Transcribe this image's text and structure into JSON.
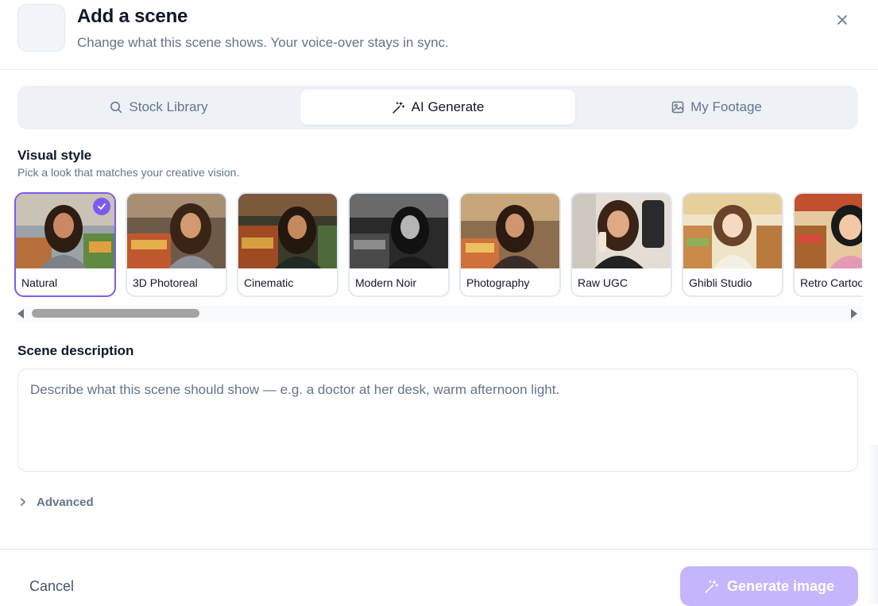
{
  "header": {
    "title": "Add a scene",
    "subtitle": "Change what this scene shows. Your voice-over stays in sync.",
    "close_icon": "close-icon"
  },
  "tabs": [
    {
      "label": "Stock Library",
      "icon": "search-icon",
      "active": false
    },
    {
      "label": "AI Generate",
      "icon": "magic-wand-icon",
      "active": true
    },
    {
      "label": "My Footage",
      "icon": "image-icon",
      "active": false
    }
  ],
  "visual_style": {
    "title": "Visual style",
    "hint": "Pick a look that matches your creative vision.",
    "selected": "Natural",
    "options": [
      {
        "label": "Natural"
      },
      {
        "label": "3D Photoreal"
      },
      {
        "label": "Cinematic"
      },
      {
        "label": "Modern Noir"
      },
      {
        "label": "Photography"
      },
      {
        "label": "Raw UGC"
      },
      {
        "label": "Ghibli Studio"
      },
      {
        "label": "Retro Cartoon"
      }
    ]
  },
  "scene_description": {
    "title": "Scene description",
    "placeholder": "Describe what this scene should show — e.g. a doctor at her desk, warm afternoon light.",
    "value": ""
  },
  "advanced": {
    "label": "Advanced",
    "icon": "chevron-right-icon"
  },
  "footer": {
    "cancel_label": "Cancel",
    "generate_label": "Generate image",
    "generate_icon": "magic-wand-icon",
    "generate_enabled": false
  },
  "colors": {
    "accent": "#7c5cf0",
    "accent_disabled": "#c4b5fd",
    "muted_text": "#64748b",
    "tab_bg": "#eef2f7"
  }
}
